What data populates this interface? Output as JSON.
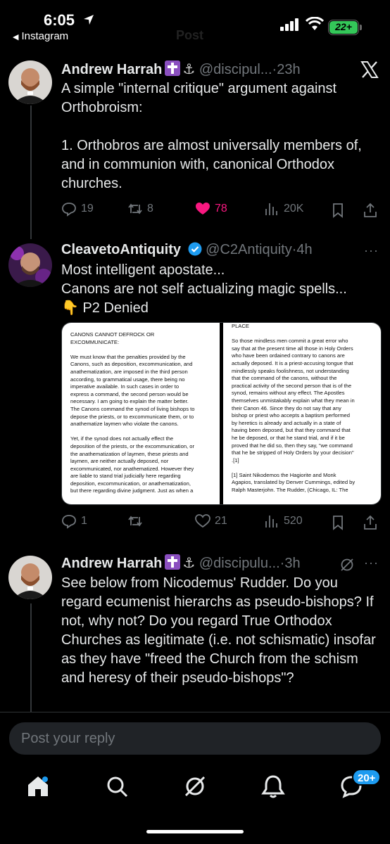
{
  "status_bar": {
    "time": "6:05",
    "back_app": "Instagram",
    "battery": "22+",
    "faded_title": "Post"
  },
  "posts": [
    {
      "name": "Andrew Harrah",
      "handle": "@discipul...",
      "separator": "·",
      "ago": "23h",
      "text": "A simple \"internal critique\" argument against Orthobroism:\n\n1. Orthobros are almost universally members of, and in communion with, canonical Orthodox churches.",
      "replies": "19",
      "reposts": "8",
      "likes": "78",
      "views": "20K"
    },
    {
      "name": "CleavetoAntiquity",
      "handle": "@C2Antiquity",
      "separator": "·",
      "ago": "4h",
      "text": "Most intelligent apostate...\nCanons are not self actualizing magic spells...\n👇 P2 Denied",
      "replies": "1",
      "reposts": "",
      "likes": "21",
      "views": "520",
      "image_left_text": "CANONS CANNOT DEFROCK OR\nEXCOMMUNICATE:\n\nWe must know that the penalties provided by the\nCanons, such as deposition, excommunication, and\nanathematization, are imposed in the third person\naccording, to grammatical usage, there being no\nimperative available. In such cases in order to\nexpress a command, the second person would be\nnecessary. I am going to explain the matter better.\nThe Canons command the synod of living bishops to\ndepose the priests, or to excommunicate them, or to\nanathematize laymen who violate the canons.\n\nYet, if the synod does not actually effect the\ndeposition of the priests, or the excommunication, or\nthe anathematization of laymen, these priests and\nlaymen, are neither actually deposed, nor\nexcommunicated, nor anathematized. However they\nare liable to stand trial judicially here regarding\ndeposition, excommunication, or anathematization,\nbut there regarding divine judgment. Just as when a",
      "image_right_text": "PLACE\n\nSo those mindless men commit a great error who\nsay that at the present time all those in Holy Orders\nwho have been ordained contrary to canons are\nactually deposed. It is a priest-accusing tongue that\nmindlessly speaks foolishness, not understanding\nthat the command of the canons, without the\npractical activity of the second person that is of the\nsynod, remains without any effect. The Apostles\nthemselves unmistakably explain what they mean in\ntheir Canon 46. Since they do not say that any\nbishop or priest who accepts a baptism performed\nby heretics is already and actually in a state of\nhaving been deposed, but that they command that\nhe be deposed, or that he stand trial, and if it be\nproved that he did so, then they say, \"we command\nthat he be stripped of Holy Orders by your decision\"\n.[1]\n\n[1] Saint Nikodemos the Hagiorite and Monk\nAgapios, translated by Denver Cummings, edited by\nRalph Masterjohn. The Rudder, (Chicago, IL: The"
    },
    {
      "name": "Andrew Harrah",
      "handle": "@discipulu...",
      "separator": "·",
      "ago": "3h",
      "text": "See below from Nicodemus' Rudder. Do you regard ecumenist hierarchs as pseudo-bishops? If not, why not? Do you regard True Orthodox Churches as legitimate (i.e. not schismatic) insofar as they have \"freed the Church from the schism and heresy of their pseudo-bishops\"?"
    }
  ],
  "more_glyph": "···",
  "composer": {
    "placeholder": "Post your reply"
  },
  "tabs": {
    "notifications_badge": "20+"
  },
  "colors": {
    "like": "#f91880",
    "accent": "#1d9bf0",
    "background": "#000000"
  }
}
